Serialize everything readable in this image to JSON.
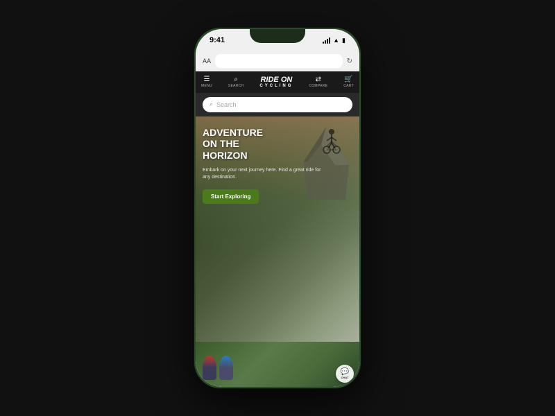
{
  "phone": {
    "status_bar": {
      "time": "9:41",
      "signal_label": "signal",
      "wifi_label": "wifi",
      "battery_label": "battery"
    },
    "browser": {
      "aa_label": "AA",
      "url_placeholder": "",
      "refresh_label": "↻"
    },
    "nav": {
      "menu_label": "MENU",
      "search_label": "SEARCH",
      "compare_label": "COMPARE",
      "cart_label": "CART",
      "logo_line1": "RIDE ON",
      "logo_line2": "CYCLING"
    },
    "search": {
      "placeholder": "Search"
    },
    "hero": {
      "title_line1": "ADVENTURE",
      "title_line2": "ON THE",
      "title_line3": "HORIZON",
      "subtitle": "Embark on your next journey here. Find a great ride for any destination.",
      "cta_label": "Start Exploring",
      "accent_color": "#4a7a1a"
    },
    "chat": {
      "label": "CHAT"
    }
  }
}
